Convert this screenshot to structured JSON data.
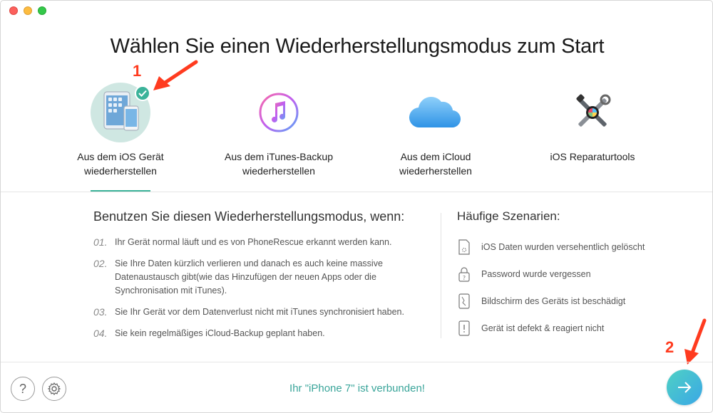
{
  "window": {
    "title": "Wählen Sie einen Wiederherstellungsmodus zum Start"
  },
  "modes": [
    {
      "label_line1": "Aus dem iOS Gerät",
      "label_line2": "wiederherstellen",
      "icon": "ios-device-icon",
      "selected": true
    },
    {
      "label_line1": "Aus dem iTunes-Backup",
      "label_line2": "wiederherstellen",
      "icon": "itunes-icon",
      "selected": false
    },
    {
      "label_line1": "Aus dem iCloud",
      "label_line2": "wiederherstellen",
      "icon": "icloud-icon",
      "selected": false
    },
    {
      "label_line1": "iOS Reparaturtools",
      "label_line2": "",
      "icon": "repair-tools-icon",
      "selected": false
    }
  ],
  "annotations": {
    "one": "1",
    "two": "2"
  },
  "usage": {
    "title": "Benutzen Sie diesen Wiederherstellungsmodus, wenn:",
    "steps": [
      {
        "num": "01.",
        "text": "Ihr Gerät normal läuft und es von PhoneRescue erkannt werden kann."
      },
      {
        "num": "02.",
        "text": "Sie Ihre Daten kürzlich verlieren und danach es auch keine massive Datenaustausch gibt(wie das Hinzufügen der neuen Apps oder die Synchronisation mit iTunes)."
      },
      {
        "num": "03.",
        "text": "Sie Ihr Gerät vor dem Datenverlust nicht mit iTunes synchronisiert haben."
      },
      {
        "num": "04.",
        "text": "Sie kein regelmäßiges iCloud-Backup geplant haben."
      }
    ]
  },
  "scenarios": {
    "title": "Häufige Szenarien:",
    "items": [
      {
        "text": "iOS Daten wurden versehentlich gelöscht",
        "icon": "deleted-data-icon"
      },
      {
        "text": "Password wurde vergessen",
        "icon": "forgot-password-icon"
      },
      {
        "text": "Bildschirm des Geräts ist beschädigt",
        "icon": "broken-screen-icon"
      },
      {
        "text": "Gerät ist defekt & reagiert nicht",
        "icon": "device-error-icon"
      }
    ]
  },
  "footer": {
    "help_label": "?",
    "status": "Ihr \"iPhone 7\" ist verbunden!"
  },
  "colors": {
    "accent": "#3cb39a",
    "annotation": "#ff3b1f",
    "status": "#3aa59a"
  }
}
